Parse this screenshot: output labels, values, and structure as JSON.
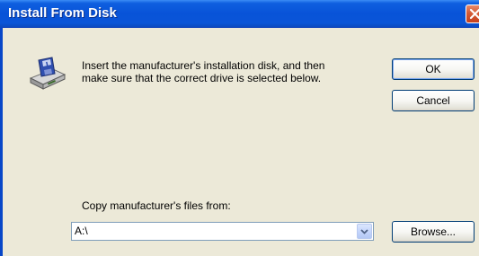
{
  "window": {
    "title": "Install From Disk"
  },
  "icons": {
    "close": "close-icon",
    "disk": "disk-drive-icon",
    "dropdown": "chevron-down-icon"
  },
  "dialog": {
    "message_line1": "Insert the manufacturer's installation disk, and then",
    "message_line2": "make sure that the correct drive is selected below.",
    "ok_label": "OK",
    "cancel_label": "Cancel",
    "copy_label": "Copy manufacturer's files from:",
    "path_value": "A:\\",
    "browse_label": "Browse..."
  },
  "colors": {
    "titlebar": "#0853d8",
    "dialog_bg": "#ece9d8",
    "close_button": "#d45a34",
    "button_border": "#003c74"
  }
}
